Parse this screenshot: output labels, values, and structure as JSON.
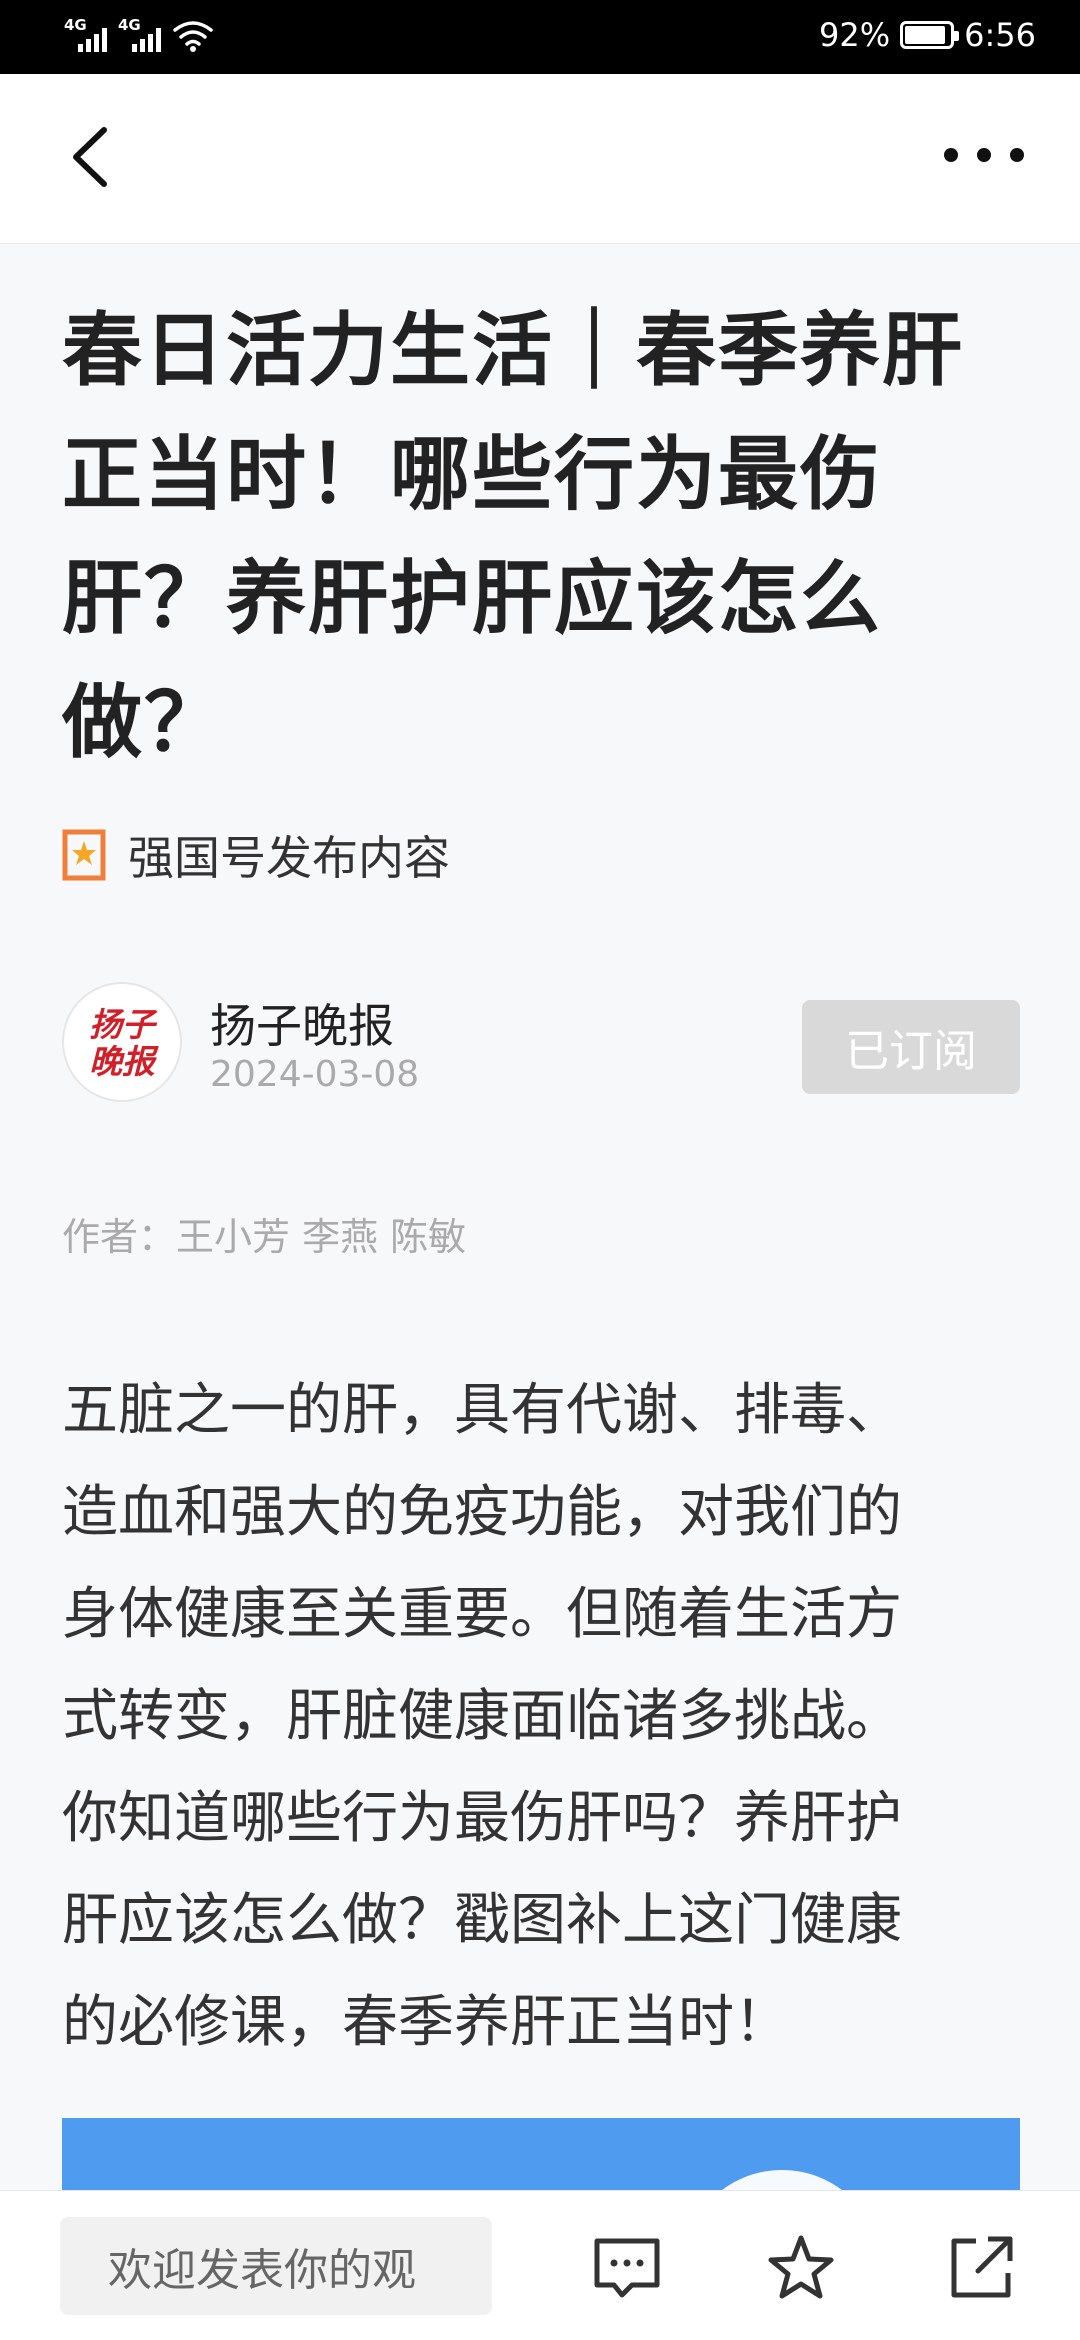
{
  "status_bar": {
    "signal1_label": "4G",
    "signal2_label": "4G",
    "battery_percent": "92%",
    "battery_level": 0.92,
    "time": "6:56"
  },
  "nav": {
    "back_icon": "chevron-left-icon",
    "more_icon": "more-horizontal-icon"
  },
  "article": {
    "title_lines": [
      "春日活力生活｜春季养肝",
      "正当时！哪些行为最伤",
      "肝？养肝护肝应该怎么",
      "做？"
    ],
    "source_label": "强国号发布内容",
    "publisher": {
      "name": "扬子晚报",
      "date": "2024-03-08",
      "logo_text": "扬子晚报",
      "subscribe_label": "已订阅"
    },
    "authors": "作者：王小芳 李燕 陈敏",
    "body_lines": [
      "五脏之一的肝，具有代谢、排毒、",
      "造血和强大的免疫功能，对我们的",
      "身体健康至关重要。但随着生活方",
      "式转变，肝脏健康面临诸多挑战。",
      "你知道哪些行为最伤肝吗？养肝护",
      "肝应该怎么做？戳图补上这门健康",
      "的必修课，春季养肝正当时！"
    ]
  },
  "bottom_bar": {
    "comment_placeholder": "欢迎发表你的观",
    "icons": [
      "comment-icon",
      "star-icon",
      "share-icon"
    ]
  },
  "colors": {
    "accent_orange": "#f07f3c",
    "logo_red": "#d0202a",
    "image_blue": "#4f9bf0"
  }
}
